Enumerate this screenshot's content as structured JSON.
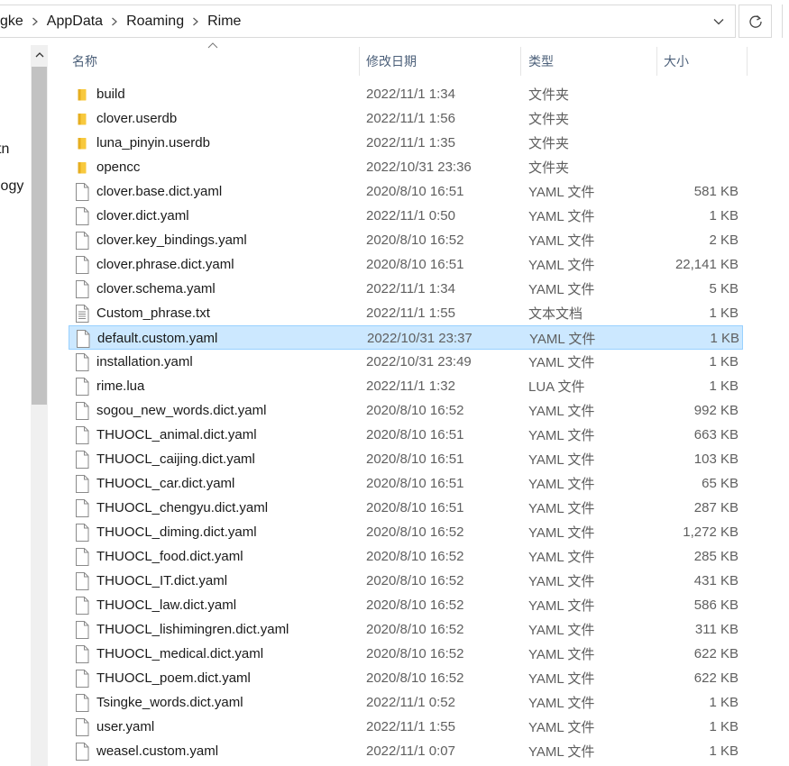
{
  "address": {
    "breadcrumbs": [
      "gke",
      "AppData",
      "Roaming",
      "Rime"
    ]
  },
  "nav_pane": {
    "items": [
      "tn",
      "logy"
    ]
  },
  "columns": {
    "name": "名称",
    "date": "修改日期",
    "type": "类型",
    "size": "大小"
  },
  "files": [
    {
      "name": "build",
      "date": "2022/11/1 1:34",
      "type": "文件夹",
      "size": "",
      "icon": "folder-icon"
    },
    {
      "name": "clover.userdb",
      "date": "2022/11/1 1:56",
      "type": "文件夹",
      "size": "",
      "icon": "folder-icon"
    },
    {
      "name": "luna_pinyin.userdb",
      "date": "2022/11/1 1:35",
      "type": "文件夹",
      "size": "",
      "icon": "folder-icon"
    },
    {
      "name": "opencc",
      "date": "2022/10/31 23:36",
      "type": "文件夹",
      "size": "",
      "icon": "folder-icon"
    },
    {
      "name": "clover.base.dict.yaml",
      "date": "2020/8/10 16:51",
      "type": "YAML 文件",
      "size": "581 KB",
      "icon": "file-icon"
    },
    {
      "name": "clover.dict.yaml",
      "date": "2022/11/1 0:50",
      "type": "YAML 文件",
      "size": "1 KB",
      "icon": "file-icon"
    },
    {
      "name": "clover.key_bindings.yaml",
      "date": "2020/8/10 16:52",
      "type": "YAML 文件",
      "size": "2 KB",
      "icon": "file-icon"
    },
    {
      "name": "clover.phrase.dict.yaml",
      "date": "2020/8/10 16:51",
      "type": "YAML 文件",
      "size": "22,141 KB",
      "icon": "file-icon"
    },
    {
      "name": "clover.schema.yaml",
      "date": "2022/11/1 1:34",
      "type": "YAML 文件",
      "size": "5 KB",
      "icon": "file-icon"
    },
    {
      "name": "Custom_phrase.txt",
      "date": "2022/11/1 1:55",
      "type": "文本文档",
      "size": "1 KB",
      "icon": "text-file-icon"
    },
    {
      "name": "default.custom.yaml",
      "date": "2022/10/31 23:37",
      "type": "YAML 文件",
      "size": "1 KB",
      "icon": "file-icon",
      "selected": true
    },
    {
      "name": "installation.yaml",
      "date": "2022/10/31 23:49",
      "type": "YAML 文件",
      "size": "1 KB",
      "icon": "file-icon"
    },
    {
      "name": "rime.lua",
      "date": "2022/11/1 1:32",
      "type": "LUA 文件",
      "size": "1 KB",
      "icon": "file-icon"
    },
    {
      "name": "sogou_new_words.dict.yaml",
      "date": "2020/8/10 16:52",
      "type": "YAML 文件",
      "size": "992 KB",
      "icon": "file-icon"
    },
    {
      "name": "THUOCL_animal.dict.yaml",
      "date": "2020/8/10 16:51",
      "type": "YAML 文件",
      "size": "663 KB",
      "icon": "file-icon"
    },
    {
      "name": "THUOCL_caijing.dict.yaml",
      "date": "2020/8/10 16:51",
      "type": "YAML 文件",
      "size": "103 KB",
      "icon": "file-icon"
    },
    {
      "name": "THUOCL_car.dict.yaml",
      "date": "2020/8/10 16:51",
      "type": "YAML 文件",
      "size": "65 KB",
      "icon": "file-icon"
    },
    {
      "name": "THUOCL_chengyu.dict.yaml",
      "date": "2020/8/10 16:51",
      "type": "YAML 文件",
      "size": "287 KB",
      "icon": "file-icon"
    },
    {
      "name": "THUOCL_diming.dict.yaml",
      "date": "2020/8/10 16:52",
      "type": "YAML 文件",
      "size": "1,272 KB",
      "icon": "file-icon"
    },
    {
      "name": "THUOCL_food.dict.yaml",
      "date": "2020/8/10 16:52",
      "type": "YAML 文件",
      "size": "285 KB",
      "icon": "file-icon"
    },
    {
      "name": "THUOCL_IT.dict.yaml",
      "date": "2020/8/10 16:52",
      "type": "YAML 文件",
      "size": "431 KB",
      "icon": "file-icon"
    },
    {
      "name": "THUOCL_law.dict.yaml",
      "date": "2020/8/10 16:52",
      "type": "YAML 文件",
      "size": "586 KB",
      "icon": "file-icon"
    },
    {
      "name": "THUOCL_lishimingren.dict.yaml",
      "date": "2020/8/10 16:52",
      "type": "YAML 文件",
      "size": "311 KB",
      "icon": "file-icon"
    },
    {
      "name": "THUOCL_medical.dict.yaml",
      "date": "2020/8/10 16:52",
      "type": "YAML 文件",
      "size": "622 KB",
      "icon": "file-icon"
    },
    {
      "name": "THUOCL_poem.dict.yaml",
      "date": "2020/8/10 16:52",
      "type": "YAML 文件",
      "size": "622 KB",
      "icon": "file-icon"
    },
    {
      "name": "Tsingke_words.dict.yaml",
      "date": "2022/11/1 0:52",
      "type": "YAML 文件",
      "size": "1 KB",
      "icon": "file-icon"
    },
    {
      "name": "user.yaml",
      "date": "2022/11/1 1:55",
      "type": "YAML 文件",
      "size": "1 KB",
      "icon": "file-icon"
    },
    {
      "name": "weasel.custom.yaml",
      "date": "2022/11/1 0:07",
      "type": "YAML 文件",
      "size": "1 KB",
      "icon": "file-icon"
    }
  ],
  "colors": {
    "selection_bg": "#cce8ff",
    "selection_border": "#99d1ff",
    "folder_yellow": "#f8c93e",
    "header_text": "#4c607a"
  }
}
